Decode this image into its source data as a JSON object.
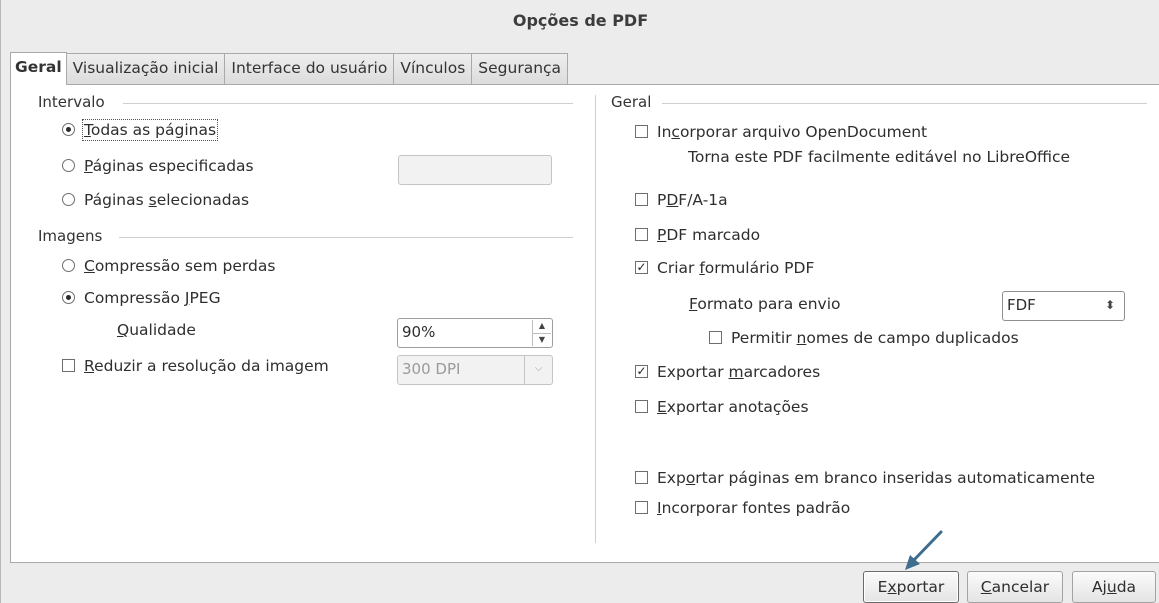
{
  "window": {
    "title": "Opções de PDF"
  },
  "tabs": [
    {
      "label": "Geral",
      "active": true
    },
    {
      "label": "Visualização inicial",
      "active": false
    },
    {
      "label": "Interface do usuário",
      "active": false
    },
    {
      "label": "Vínculos",
      "active": false
    },
    {
      "label": "Segurança",
      "active": false
    }
  ],
  "intervalo": {
    "title": "Intervalo",
    "all_pages": {
      "pre": "",
      "u": "T",
      "post": "odas as páginas",
      "selected": true
    },
    "specific_pages": {
      "pre": "",
      "u": "P",
      "post": "áginas especificadas",
      "selected": false,
      "value": ""
    },
    "selected_pages": {
      "pre": "Páginas ",
      "u": "s",
      "post": "elecionadas",
      "selected": false
    }
  },
  "imagens": {
    "title": "Imagens",
    "lossless": {
      "pre": "",
      "u": "C",
      "post": "ompressão sem perdas",
      "selected": false
    },
    "jpeg": {
      "pre": "Compressão ",
      "u": "J",
      "post": "PEG",
      "selected": true
    },
    "quality": {
      "pre": "",
      "u": "Q",
      "post": "ualidade",
      "value": "90%"
    },
    "reduce": {
      "pre": "",
      "u": "R",
      "post": "eduzir a resolução da imagem",
      "checked": false,
      "value": "300 DPI"
    }
  },
  "geral": {
    "title": "Geral",
    "embed_odf": {
      "pre": "In",
      "u": "c",
      "post": "orporar arquivo OpenDocument",
      "checked": false,
      "note": "Torna este PDF facilmente editável no LibreOffice"
    },
    "pdfa": {
      "pre": "P",
      "u": "D",
      "post": "F/A-1a",
      "checked": false
    },
    "tagged": {
      "pre": "",
      "u": "P",
      "post": "DF marcado",
      "checked": false
    },
    "create_form": {
      "pre": "Criar ",
      "u": "f",
      "post": "ormulário PDF",
      "checked": true
    },
    "submit_format": {
      "pre": "",
      "u": "F",
      "post": "ormato para envio",
      "value": "FDF"
    },
    "allow_dup": {
      "pre": "Permitir ",
      "u": "n",
      "post": "omes de campo duplicados",
      "checked": false
    },
    "export_bookmarks": {
      "pre": "Exportar ",
      "u": "m",
      "post": "arcadores",
      "checked": true
    },
    "export_notes": {
      "pre": "",
      "u": "E",
      "post": "xportar anotações",
      "checked": false
    },
    "export_blank": {
      "pre": "Exp",
      "u": "o",
      "post": "rtar páginas em branco inseridas automaticamente",
      "checked": false
    },
    "embed_fonts": {
      "pre": "",
      "u": "I",
      "post": "ncorporar fontes padrão",
      "checked": false
    }
  },
  "buttons": {
    "export": {
      "pre": "E",
      "u": "x",
      "post": "portar"
    },
    "cancel": {
      "pre": "",
      "u": "C",
      "post": "ancelar"
    },
    "help": {
      "pre": "Aj",
      "u": "u",
      "post": "da"
    }
  },
  "colors": {
    "arrow": "#3f6d8e"
  }
}
